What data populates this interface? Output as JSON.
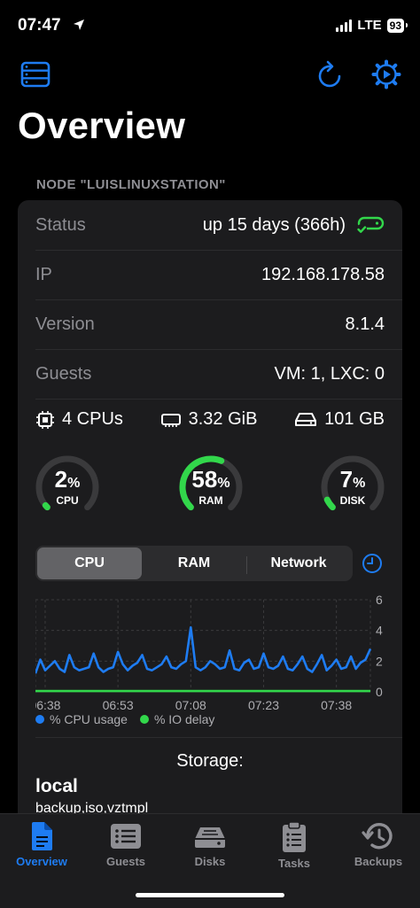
{
  "status_bar": {
    "time": "07:47",
    "network": "LTE",
    "battery": "93"
  },
  "page": {
    "title": "Overview",
    "section_header": "NODE \"LUISLINUXSTATION\""
  },
  "node": {
    "rows": [
      {
        "label": "Status",
        "value": "up 15 days (366h)"
      },
      {
        "label": "IP",
        "value": "192.168.178.58"
      },
      {
        "label": "Version",
        "value": "8.1.4"
      },
      {
        "label": "Guests",
        "value": "VM: 1, LXC: 0"
      }
    ],
    "specs": {
      "cpus": "4 CPUs",
      "ram": "3.32 GiB",
      "disk": "101 GB"
    },
    "gauges": [
      {
        "value": "2",
        "unit": "%",
        "label": "CPU",
        "percent": 2
      },
      {
        "value": "58",
        "unit": "%",
        "label": "RAM",
        "percent": 58
      },
      {
        "value": "7",
        "unit": "%",
        "label": "DISK",
        "percent": 7
      }
    ]
  },
  "segmented": {
    "tabs": [
      "CPU",
      "RAM",
      "Network"
    ],
    "selected": "CPU"
  },
  "chart_data": {
    "type": "line",
    "x": [
      "06:36",
      "06:37",
      "06:38",
      "06:39",
      "06:40",
      "06:41",
      "06:42",
      "06:43",
      "06:44",
      "06:45",
      "06:46",
      "06:47",
      "06:48",
      "06:49",
      "06:50",
      "06:51",
      "06:52",
      "06:53",
      "06:54",
      "06:55",
      "06:56",
      "06:57",
      "06:58",
      "06:59",
      "07:00",
      "07:01",
      "07:02",
      "07:03",
      "07:04",
      "07:05",
      "07:06",
      "07:07",
      "07:08",
      "07:09",
      "07:10",
      "07:11",
      "07:12",
      "07:13",
      "07:14",
      "07:15",
      "07:16",
      "07:17",
      "07:18",
      "07:19",
      "07:20",
      "07:21",
      "07:22",
      "07:23",
      "07:24",
      "07:25",
      "07:26",
      "07:27",
      "07:28",
      "07:29",
      "07:30",
      "07:31",
      "07:32",
      "07:33",
      "07:34",
      "07:35",
      "07:36",
      "07:37",
      "07:38",
      "07:39",
      "07:40",
      "07:41",
      "07:42",
      "07:43",
      "07:44",
      "07:45"
    ],
    "xticks": [
      "06:38",
      "06:53",
      "07:08",
      "07:23",
      "07:38"
    ],
    "ylim": [
      0,
      6
    ],
    "yticks": [
      0,
      2,
      4,
      6
    ],
    "series": [
      {
        "name": "% CPU usage",
        "color": "#1e7cf2",
        "values": [
          1.2,
          2.1,
          1.4,
          1.7,
          2.0,
          1.5,
          1.3,
          2.4,
          1.6,
          1.4,
          1.5,
          1.6,
          2.5,
          1.6,
          1.3,
          1.5,
          1.6,
          2.6,
          1.8,
          1.4,
          1.7,
          1.9,
          2.4,
          1.5,
          1.4,
          1.6,
          1.8,
          2.3,
          1.6,
          1.5,
          1.8,
          2.0,
          4.2,
          1.6,
          1.4,
          1.6,
          2.0,
          1.8,
          1.5,
          1.6,
          2.7,
          1.5,
          1.4,
          1.9,
          2.1,
          1.5,
          1.6,
          2.5,
          1.6,
          1.5,
          1.7,
          2.3,
          1.5,
          1.4,
          1.8,
          2.3,
          1.5,
          1.3,
          1.8,
          2.4,
          1.4,
          1.7,
          2.1,
          1.5,
          1.6,
          2.3,
          1.5,
          1.9,
          2.1,
          2.8
        ]
      },
      {
        "name": "% IO delay",
        "color": "#32d74b",
        "values": [
          0.05,
          0.05,
          0.05,
          0.06,
          0.05,
          0.05,
          0.05,
          0.05,
          0.06,
          0.05,
          0.05,
          0.05,
          0.05,
          0.05,
          0.05,
          0.06,
          0.05,
          0.05,
          0.05,
          0.05,
          0.05,
          0.05,
          0.05,
          0.06,
          0.05,
          0.05,
          0.05,
          0.05,
          0.05,
          0.05,
          0.05,
          0.06,
          0.05,
          0.05,
          0.05,
          0.05,
          0.05,
          0.05,
          0.05,
          0.05,
          0.06,
          0.05,
          0.05,
          0.05,
          0.05,
          0.05,
          0.05,
          0.05,
          0.05,
          0.06,
          0.05,
          0.05,
          0.05,
          0.05,
          0.05,
          0.05,
          0.05,
          0.05,
          0.06,
          0.05,
          0.05,
          0.05,
          0.05,
          0.05,
          0.05,
          0.05,
          0.05,
          0.06,
          0.05,
          0.05
        ]
      }
    ]
  },
  "storage": {
    "title": "Storage:",
    "name": "local",
    "content": "backup,iso,vztmpl"
  },
  "tabbar": {
    "items": [
      {
        "label": "Overview",
        "icon": "document-icon"
      },
      {
        "label": "Guests",
        "icon": "list-icon"
      },
      {
        "label": "Disks",
        "icon": "disk-icon"
      },
      {
        "label": "Tasks",
        "icon": "clipboard-icon"
      },
      {
        "label": "Backups",
        "icon": "backup-clock-icon"
      }
    ],
    "active": "Overview"
  },
  "colors": {
    "accent": "#1e7cf2",
    "good": "#32d74b",
    "card": "#1c1c1e"
  }
}
